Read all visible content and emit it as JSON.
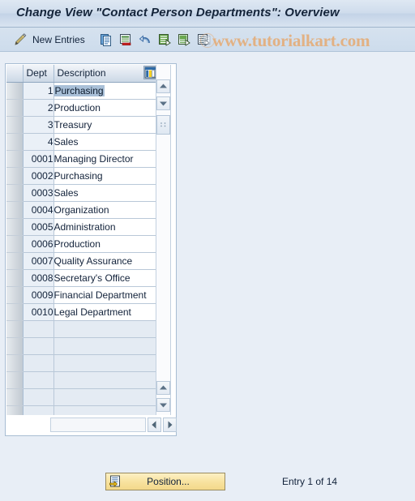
{
  "window": {
    "title": "Change View \"Contact Person Departments\": Overview"
  },
  "toolbar": {
    "edit_icon": "pencil-icon",
    "new_entries_label": "New Entries",
    "icons": [
      {
        "name": "copy-icon",
        "title": "Copy As..."
      },
      {
        "name": "delete-icon",
        "title": "Delete"
      },
      {
        "name": "undo-icon",
        "title": "Undo Change"
      },
      {
        "name": "select-all-icon",
        "title": "Select All"
      },
      {
        "name": "select-block-icon",
        "title": "Select Block"
      },
      {
        "name": "deselect-all-icon",
        "title": "Deselect All"
      }
    ]
  },
  "watermark": {
    "text": "www.tutorialkart.com"
  },
  "table": {
    "config_icon": "column-settings-icon",
    "columns": [
      {
        "key": "dept",
        "label": "Dept"
      },
      {
        "key": "desc",
        "label": "Description"
      }
    ],
    "rows": [
      {
        "dept": "1",
        "desc": "Purchasing",
        "selected": true
      },
      {
        "dept": "2",
        "desc": "Production",
        "selected": false
      },
      {
        "dept": "3",
        "desc": "Treasury",
        "selected": false
      },
      {
        "dept": "4",
        "desc": "Sales",
        "selected": false
      },
      {
        "dept": "0001",
        "desc": "Managing Director",
        "selected": false
      },
      {
        "dept": "0002",
        "desc": "Purchasing",
        "selected": false
      },
      {
        "dept": "0003",
        "desc": "Sales",
        "selected": false
      },
      {
        "dept": "0004",
        "desc": "Organization",
        "selected": false
      },
      {
        "dept": "0005",
        "desc": "Administration",
        "selected": false
      },
      {
        "dept": "0006",
        "desc": "Production",
        "selected": false
      },
      {
        "dept": "0007",
        "desc": "Quality Assurance",
        "selected": false
      },
      {
        "dept": "0008",
        "desc": "Secretary's Office",
        "selected": false
      },
      {
        "dept": "0009",
        "desc": "Financial Department",
        "selected": false
      },
      {
        "dept": "0010",
        "desc": "Legal Department",
        "selected": false
      }
    ],
    "empty_row_count": 6
  },
  "footer": {
    "position_button_label": "Position...",
    "position_button_icon": "position-icon",
    "entry_status": "Entry 1 of 14"
  },
  "colors": {
    "background": "#e8eef6",
    "titlebar": "#cfdcec",
    "accent_button": "#f8e3a0",
    "selection": "#a9c0d8",
    "watermark": "#e2b183"
  }
}
